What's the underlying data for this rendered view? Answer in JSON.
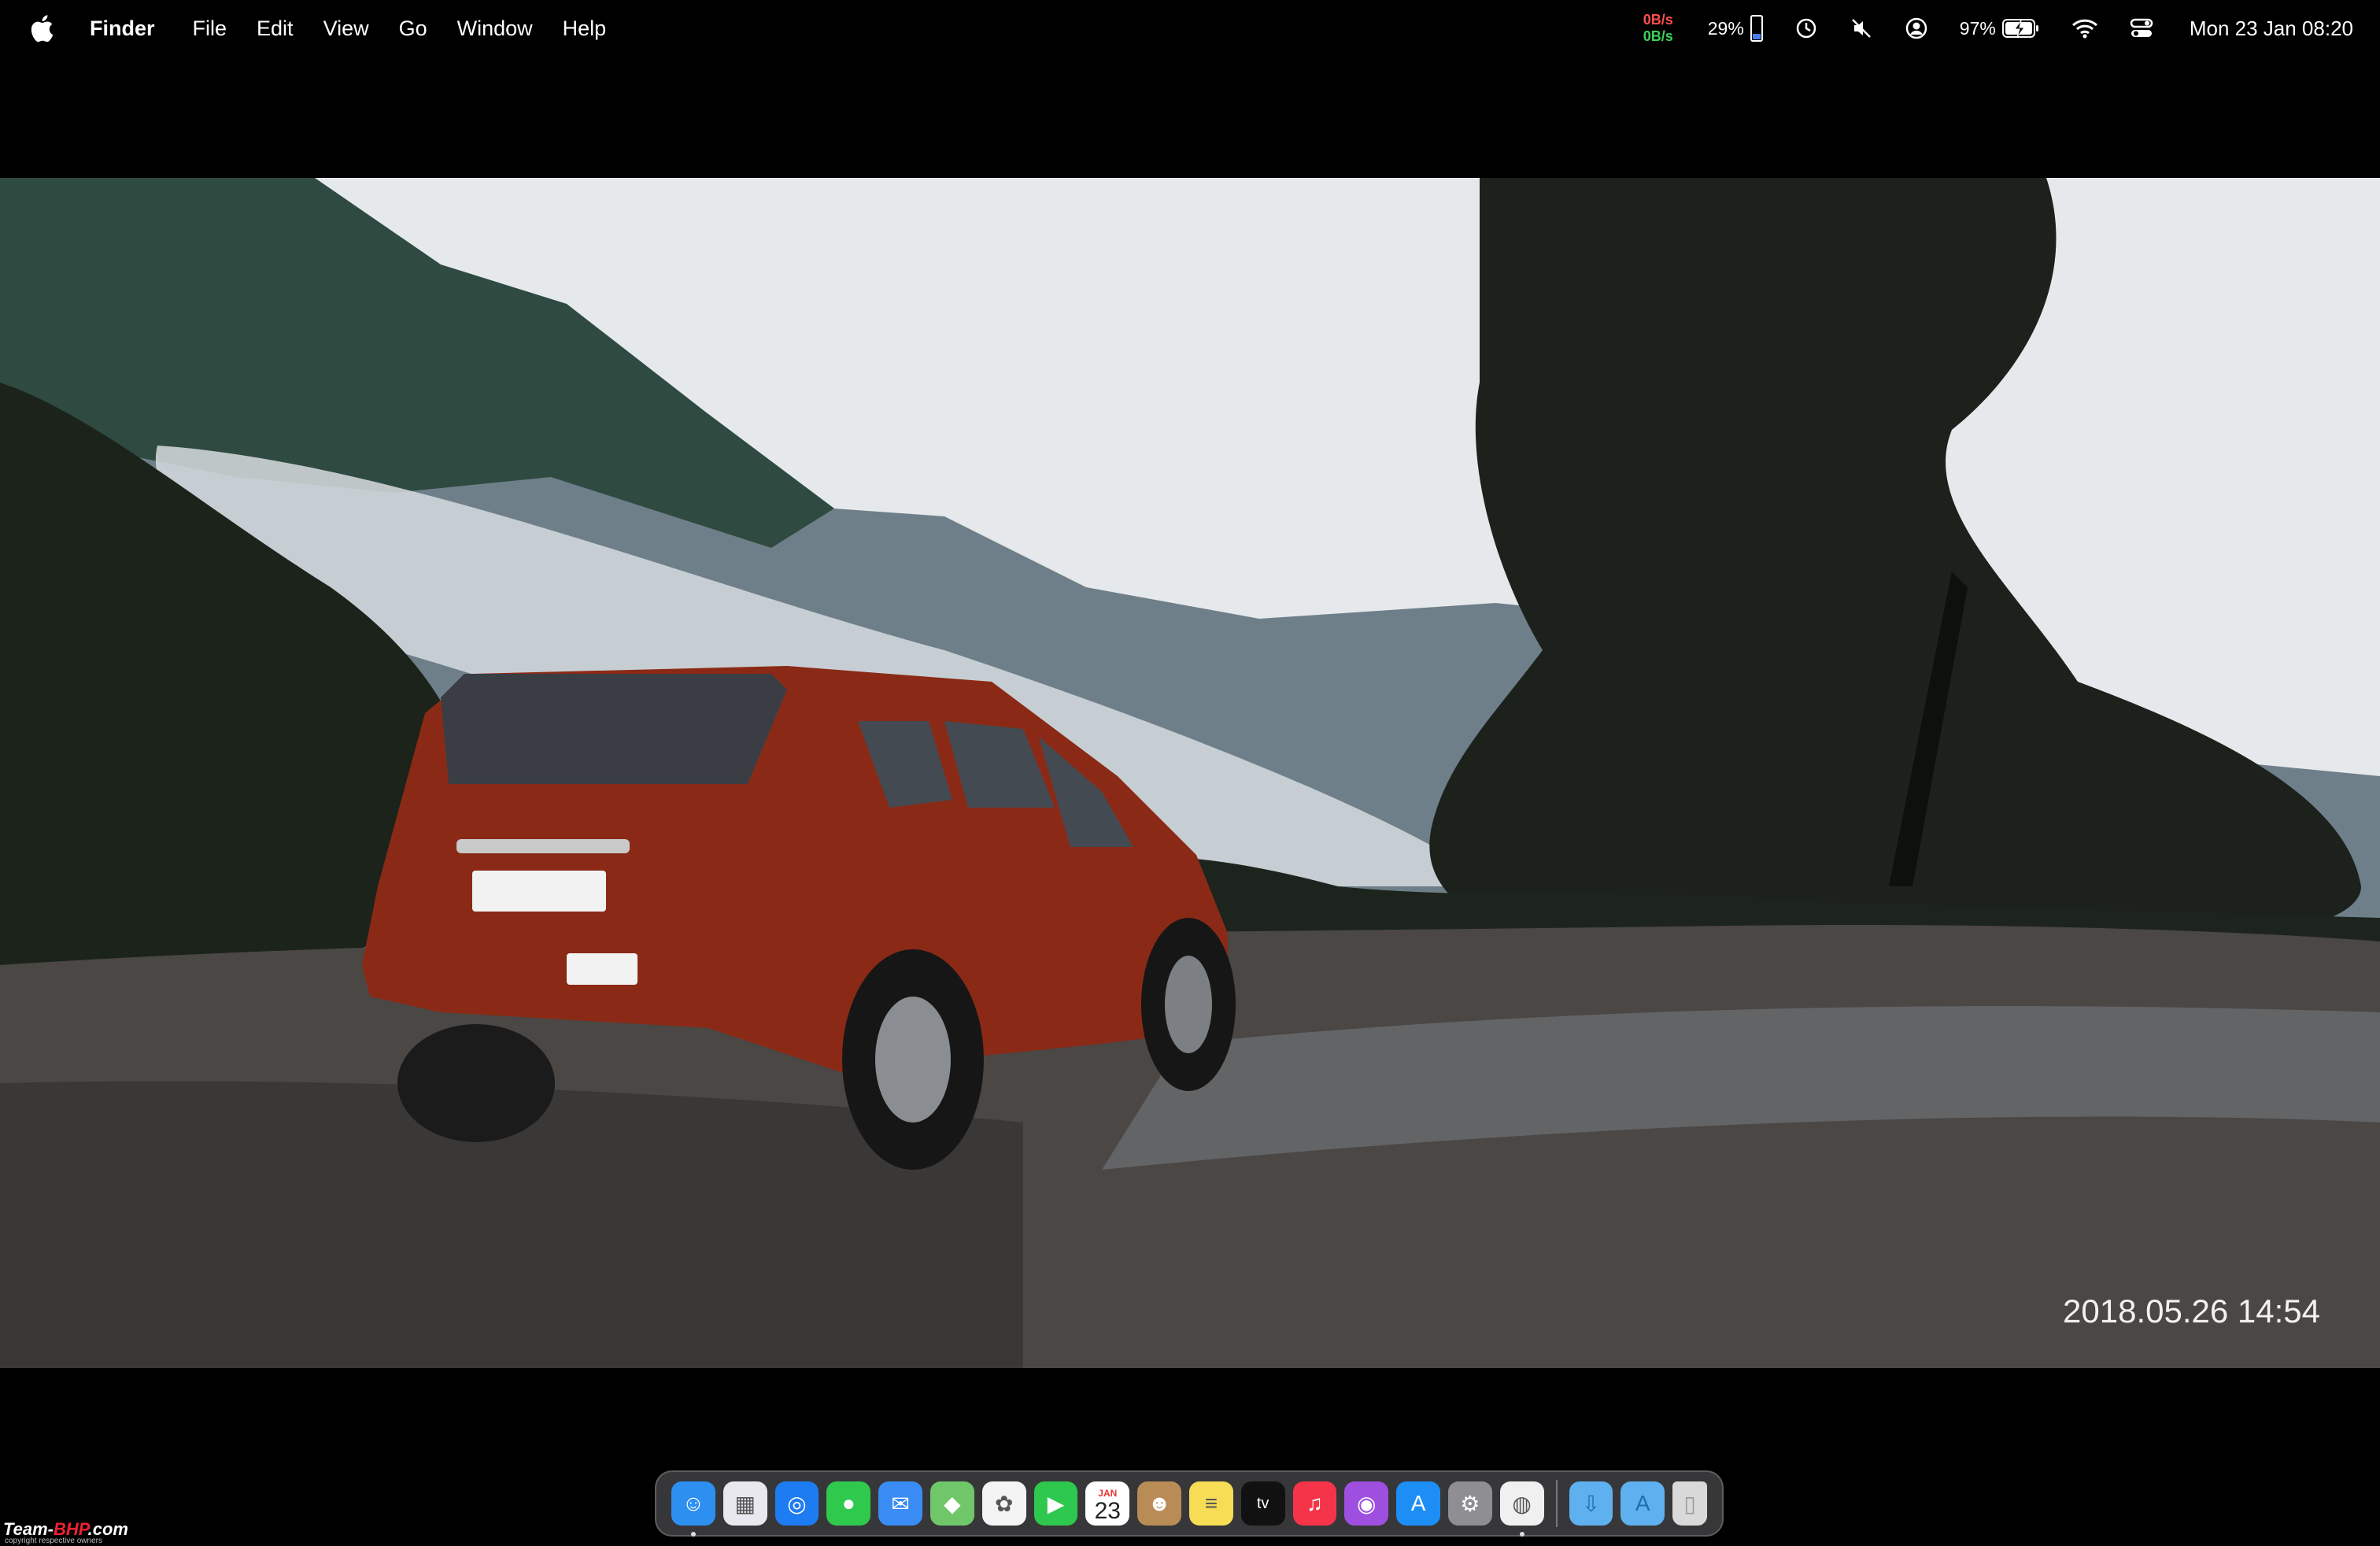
{
  "menubar": {
    "app_name": "Finder",
    "menus": [
      "File",
      "Edit",
      "View",
      "Go",
      "Window",
      "Help"
    ],
    "net_up": "0B/s",
    "net_down": "0B/s",
    "cpu_pct": "29%",
    "battery_pct": "97%",
    "datetime": "Mon 23 Jan  08:20",
    "status_icons": [
      "battery-gauge-icon",
      "time-machine-icon",
      "mute-icon",
      "user-icon",
      "battery-charging-icon",
      "wifi-icon",
      "control-center-icon"
    ]
  },
  "desktop": {
    "photo_timestamp": "2018.05.26  14:54"
  },
  "dock": {
    "apps": [
      {
        "name": "Finder",
        "icon": "finder-icon",
        "color": "#2d8ff0",
        "running": true
      },
      {
        "name": "Launchpad",
        "icon": "launchpad-icon",
        "color": "#e8e8ee",
        "running": false
      },
      {
        "name": "Safari",
        "icon": "safari-icon",
        "color": "#1e7cf2",
        "running": false
      },
      {
        "name": "Messages",
        "icon": "messages-icon",
        "color": "#2fc94e",
        "running": false
      },
      {
        "name": "Mail",
        "icon": "mail-icon",
        "color": "#3a8df5",
        "running": false
      },
      {
        "name": "Maps",
        "icon": "maps-icon",
        "color": "#6fc76a",
        "running": false
      },
      {
        "name": "Photos",
        "icon": "photos-icon",
        "color": "#f4f4f4",
        "running": false
      },
      {
        "name": "FaceTime",
        "icon": "facetime-icon",
        "color": "#2ec84e",
        "running": false
      },
      {
        "name": "Calendar",
        "icon": "calendar-icon",
        "color": "#ffffff",
        "running": false
      },
      {
        "name": "Contacts",
        "icon": "contacts-icon",
        "color": "#b98c56",
        "running": false
      },
      {
        "name": "Notes",
        "icon": "notes-icon",
        "color": "#f7dc55",
        "running": false
      },
      {
        "name": "TV",
        "icon": "apple-tv-icon",
        "color": "#111111",
        "running": false
      },
      {
        "name": "Music",
        "icon": "music-icon",
        "color": "#f5344a",
        "running": false
      },
      {
        "name": "Podcasts",
        "icon": "podcasts-icon",
        "color": "#9f4fe0",
        "running": false
      },
      {
        "name": "App Store",
        "icon": "app-store-icon",
        "color": "#1c8ef5",
        "running": false
      },
      {
        "name": "System Settings",
        "icon": "settings-icon",
        "color": "#8e8e93",
        "running": false
      },
      {
        "name": "Chrome",
        "icon": "chrome-icon",
        "color": "#f0f0f0",
        "running": true
      }
    ],
    "folders": [
      {
        "name": "Downloads",
        "icon": "downloads-folder-icon",
        "color": "#5fb0ee"
      },
      {
        "name": "Applications",
        "icon": "applications-folder-icon",
        "color": "#5fb0ee"
      },
      {
        "name": "Trash",
        "icon": "trash-icon",
        "color": "#d9d9d9"
      }
    ],
    "calendar_month": "JAN",
    "calendar_day": "23"
  },
  "watermark": {
    "text_a": "Team-",
    "text_b": "BHP",
    "text_c": ".com",
    "sub": "copyright respective owners"
  }
}
